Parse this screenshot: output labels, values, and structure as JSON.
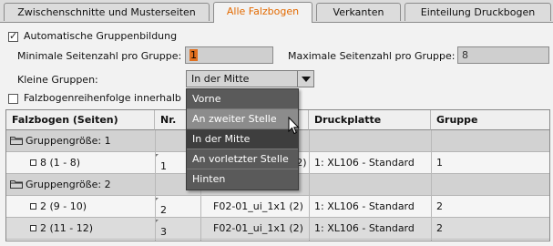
{
  "tabs": [
    {
      "label": "Zwischenschnitte und Musterseiten",
      "active": false
    },
    {
      "label": "Alle Falzbogen",
      "active": true
    },
    {
      "label": "Verkanten",
      "active": false
    },
    {
      "label": "Einteilung Druckbogen",
      "active": false
    }
  ],
  "options": {
    "auto_group_label": "Automatische Gruppenbildung",
    "auto_group_checked": true,
    "min_pages_label": "Minimale Seitenzahl pro Gruppe:",
    "min_pages_value": "1",
    "max_pages_label": "Maximale Seitenzahl pro Gruppe:",
    "max_pages_value": "8",
    "small_groups_label": "Kleine Gruppen:",
    "small_groups_value": "In der Mitte",
    "order_label": "Falzbogenreihenfolge innerhalb",
    "order_checked": false
  },
  "dropdown": {
    "items": [
      "Vorne",
      "An zweiter Stelle",
      "In der Mitte",
      "An vorletzter Stelle",
      "Hinten"
    ],
    "hover_index": 1,
    "selected_index": 2
  },
  "table": {
    "headers": [
      "Falzbogen (Seiten)",
      "Nr.",
      "",
      "Druckplatte",
      "Gruppe"
    ],
    "rows": [
      {
        "kind": "group",
        "label": "Gruppengröße: 1"
      },
      {
        "kind": "item",
        "label": "8 (1 - 8)",
        "nr": "1",
        "scheme": "1x1  (2)",
        "plate": "1: XL106 - Standard",
        "group": "1"
      },
      {
        "kind": "group",
        "label": "Gruppengröße: 2"
      },
      {
        "kind": "item",
        "label": "2 (9 - 10)",
        "nr": "2",
        "scheme": "F02-01_ui_1x1  (2)",
        "plate": "1: XL106 - Standard",
        "group": "2"
      },
      {
        "kind": "item",
        "label": "2 (11 - 12)",
        "nr": "3",
        "scheme": "F02-01_ui_1x1  (2)",
        "plate": "1: XL106 - Standard",
        "group": "2"
      }
    ]
  },
  "colors": {
    "accent": "#e36a00",
    "dropdown_bg": "#5a5a5a",
    "dropdown_hover": "#8c8c8c"
  }
}
